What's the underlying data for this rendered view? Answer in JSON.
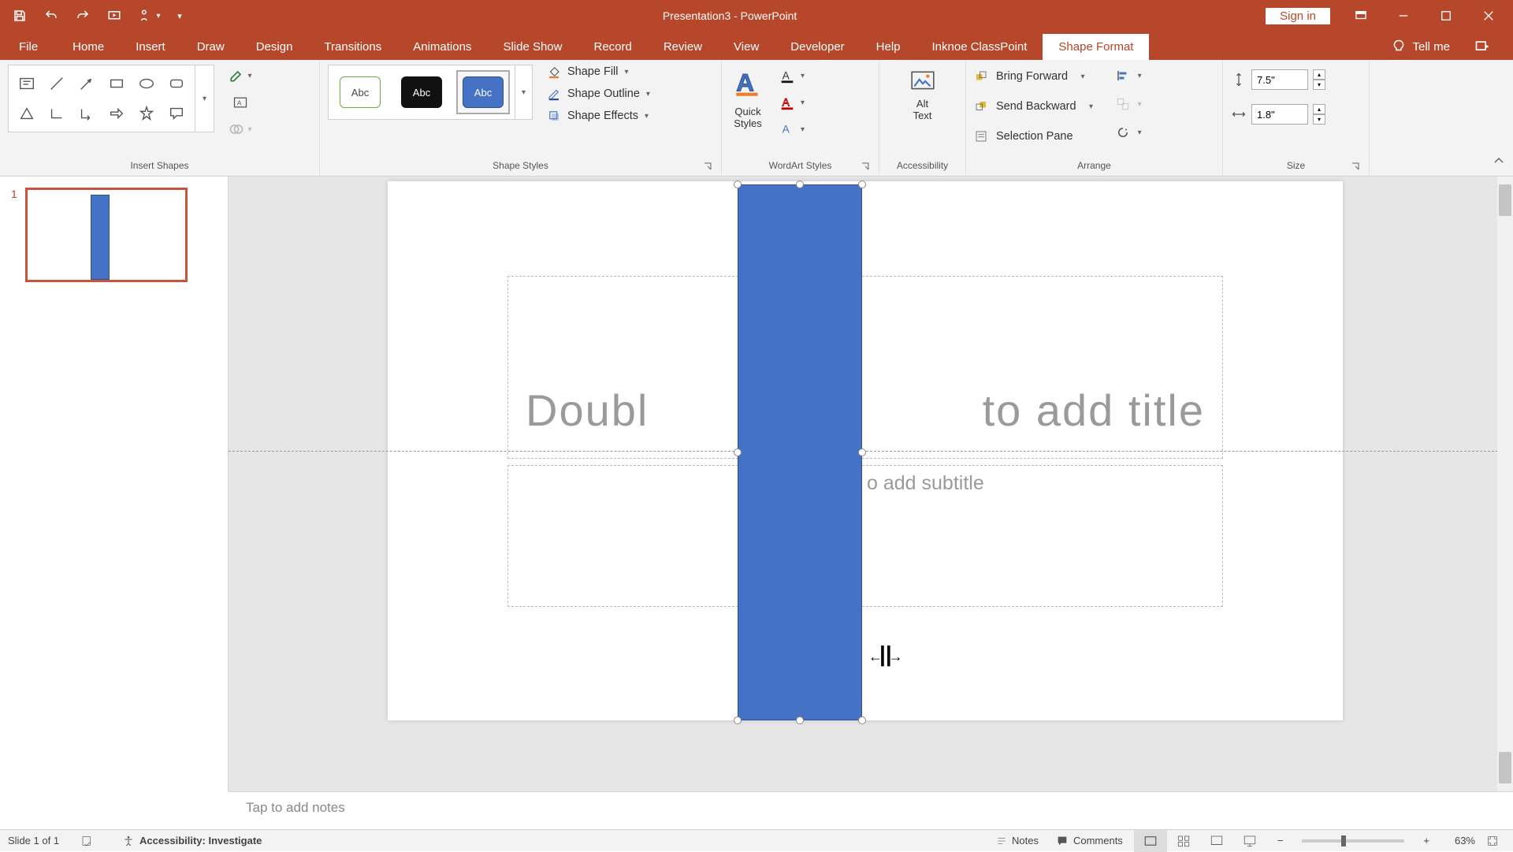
{
  "title": "Presentation3  -  PowerPoint",
  "signin": "Sign in",
  "tabs": {
    "file": "File",
    "home": "Home",
    "insert": "Insert",
    "draw": "Draw",
    "design": "Design",
    "transitions": "Transitions",
    "animations": "Animations",
    "slideshow": "Slide Show",
    "record": "Record",
    "review": "Review",
    "view": "View",
    "developer": "Developer",
    "help": "Help",
    "classpoint": "Inknoe ClassPoint",
    "shapeformat": "Shape Format",
    "tellme": "Tell me"
  },
  "groups": {
    "insert_shapes": "Insert Shapes",
    "shape_styles": "Shape Styles",
    "wordart": "WordArt Styles",
    "accessibility": "Accessibility",
    "arrange": "Arrange",
    "size": "Size"
  },
  "style_gallery": {
    "label": "Abc"
  },
  "shape_fill": "Shape Fill",
  "shape_outline": "Shape Outline",
  "shape_effects": "Shape Effects",
  "quick_styles": "Quick\nStyles",
  "alt_text": "Alt\nText",
  "bring_forward": "Bring Forward",
  "send_backward": "Send Backward",
  "selection_pane": "Selection Pane",
  "size": {
    "height": "7.5\"",
    "width": "1.8\""
  },
  "slide": {
    "number": "1",
    "title_placeholder": "Double tap to add title",
    "title_visible_left": "Doubl",
    "title_visible_right": "to add title",
    "subtitle_placeholder": "Double tap to add subtitle",
    "subtitle_visible_right": "o add subtitle"
  },
  "notes_placeholder": "Tap to add notes",
  "status": {
    "slide": "Slide 1 of 1",
    "accessibility": "Accessibility: Investigate",
    "notes": "Notes",
    "comments": "Comments",
    "zoom": "63%"
  }
}
